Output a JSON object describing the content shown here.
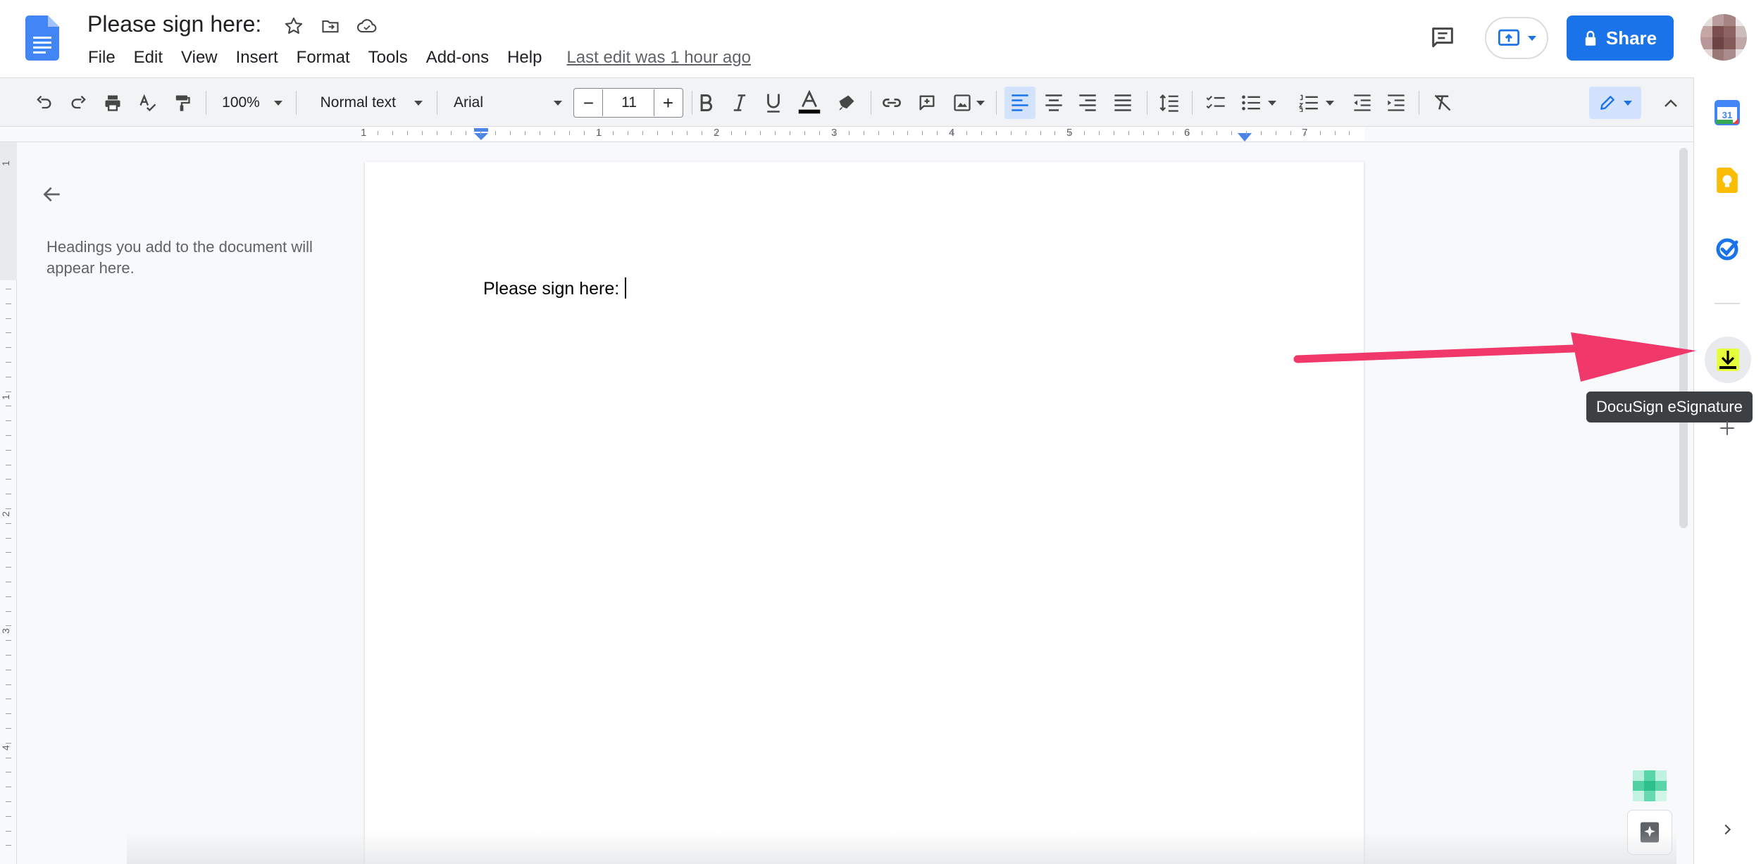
{
  "document": {
    "title": "Please sign here:",
    "body_text": "Please sign here:"
  },
  "menu": [
    "File",
    "Edit",
    "View",
    "Insert",
    "Format",
    "Tools",
    "Add-ons",
    "Help"
  ],
  "last_edit": "Last edit was 1 hour ago",
  "header": {
    "share_label": "Share"
  },
  "toolbar": {
    "zoom": "100%",
    "style": "Normal text",
    "font": "Arial",
    "font_size": "11",
    "minus": "−",
    "plus": "+"
  },
  "ruler": {
    "labels": [
      "1",
      "1",
      "2",
      "3",
      "4",
      "5",
      "6",
      "7"
    ],
    "vertical_labels": [
      "1",
      "1",
      "2",
      "3",
      "4"
    ]
  },
  "outline": {
    "hint": "Headings you add to the document will appear here."
  },
  "side_panel": {
    "tooltip": "DocuSign eSignature",
    "calendar_day": "31"
  },
  "colors": {
    "accent": "#1a73e8",
    "annotation_arrow": "#f0386b",
    "docusign": "#e6ff3a",
    "keep": "#fbbc04"
  }
}
